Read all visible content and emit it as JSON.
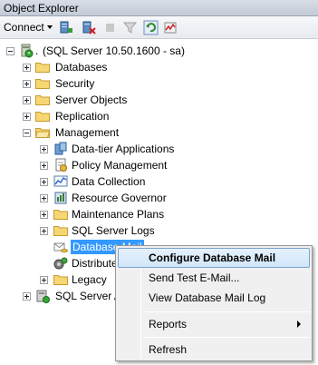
{
  "window": {
    "title": "Object Explorer"
  },
  "toolbar": {
    "connect_label": "Connect"
  },
  "tree": {
    "server": "(SQL Server 10.50.1600 - sa)",
    "items": [
      {
        "label": "Databases"
      },
      {
        "label": "Security"
      },
      {
        "label": "Server Objects"
      },
      {
        "label": "Replication"
      },
      {
        "label": "Management"
      }
    ],
    "management_children": [
      {
        "label": "Data-tier Applications"
      },
      {
        "label": "Policy Management"
      },
      {
        "label": "Data Collection"
      },
      {
        "label": "Resource Governor"
      },
      {
        "label": "Maintenance Plans"
      },
      {
        "label": "SQL Server Logs"
      },
      {
        "label": "Database Mail"
      },
      {
        "label": "Distributed Transaction Coordinator"
      },
      {
        "label": "Legacy"
      }
    ],
    "agent": {
      "label": "SQL Server Agent"
    }
  },
  "context_menu": {
    "items": [
      {
        "label": "Configure Database Mail"
      },
      {
        "label": "Send Test E-Mail..."
      },
      {
        "label": "View Database Mail Log"
      },
      {
        "label": "Reports"
      },
      {
        "label": "Refresh"
      }
    ]
  }
}
